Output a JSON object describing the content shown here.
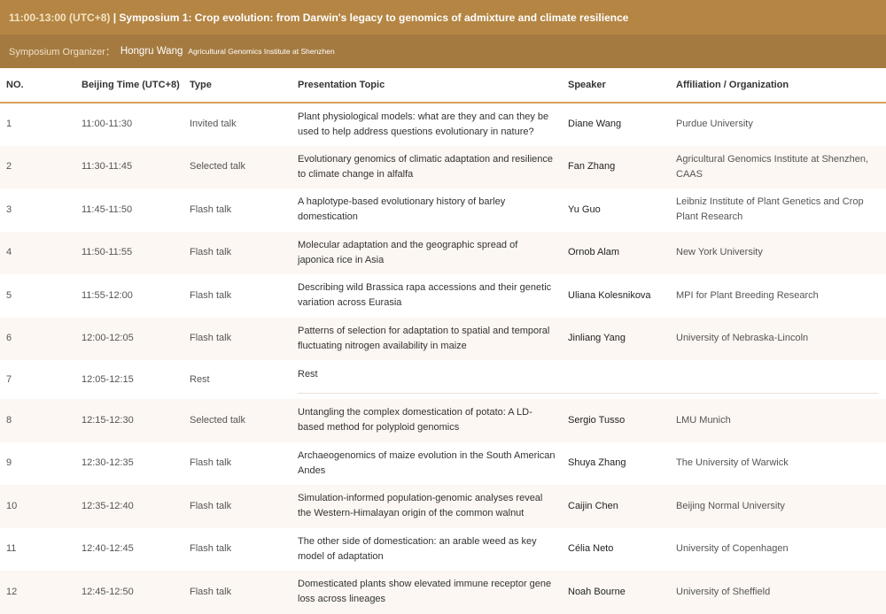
{
  "header": {
    "time": "11:00-13:00 (UTC+8)",
    "separator": " | ",
    "title": "Symposium 1: Crop evolution: from Darwin's legacy to genomics of admixture and climate resilience"
  },
  "organizer": {
    "label": "Symposium Organizer：",
    "name": "Hongru Wang",
    "institution": "Agricultural Genomics Institute at Shenzhen"
  },
  "columns": [
    "NO.",
    "Beijing Time (UTC+8)",
    "Type",
    "Presentation Topic",
    "Speaker",
    "Affiliation / Organization"
  ],
  "rows": [
    {
      "no": "1",
      "time": "11:00-11:30",
      "type": "Invited talk",
      "topic": "Plant physiological models: what are they and can they be used to help address questions evolutionary in nature?",
      "speaker": "Diane Wang",
      "affiliation": "Purdue University"
    },
    {
      "no": "2",
      "time": "11:30-11:45",
      "type": "Selected talk",
      "topic": "Evolutionary genomics of climatic adaptation and resilience to climate change in alfalfa",
      "speaker": "Fan Zhang",
      "affiliation": "Agricultural Genomics Institute at Shenzhen, CAAS"
    },
    {
      "no": "3",
      "time": "11:45-11:50",
      "type": "Flash talk",
      "topic": "A haplotype-based evolutionary history of barley domestication",
      "speaker": "Yu Guo",
      "affiliation": "Leibniz Institute of Plant Genetics and Crop Plant Research"
    },
    {
      "no": "4",
      "time": "11:50-11:55",
      "type": "Flash talk",
      "topic": "Molecular adaptation and the geographic spread of japonica rice in Asia",
      "speaker": "Ornob Alam",
      "affiliation": "New York University"
    },
    {
      "no": "5",
      "time": "11:55-12:00",
      "type": "Flash talk",
      "topic": "Describing wild Brassica rapa accessions and their genetic variation across Eurasia",
      "speaker": "Uliana Kolesnikova",
      "affiliation": "MPI for Plant Breeding Research"
    },
    {
      "no": "6",
      "time": "12:00-12:05",
      "type": "Flash talk",
      "topic": "Patterns of selection for adaptation to spatial and temporal fluctuating nitrogen availability in maize",
      "speaker": "Jinliang Yang",
      "affiliation": "University of Nebraska-Lincoln"
    },
    {
      "no": "7",
      "time": "12:05-12:15",
      "type": "Rest",
      "topic": "Rest",
      "speaker": "",
      "affiliation": ""
    },
    {
      "no": "8",
      "time": "12:15-12:30",
      "type": "Selected talk",
      "topic": "Untangling the complex domestication of potato: A LD-based method for polyploid genomics",
      "speaker": "Sergio Tusso",
      "affiliation": "LMU Munich"
    },
    {
      "no": "9",
      "time": "12:30-12:35",
      "type": "Flash talk",
      "topic": "Archaeogenomics of maize evolution in the South American Andes",
      "speaker": "Shuya Zhang",
      "affiliation": "The University of Warwick"
    },
    {
      "no": "10",
      "time": "12:35-12:40",
      "type": "Flash talk",
      "topic": "Simulation-informed population-genomic analyses reveal the Western-Himalayan origin of the common walnut",
      "speaker": "Caijin Chen",
      "affiliation": "Beijing Normal University"
    },
    {
      "no": "11",
      "time": "12:40-12:45",
      "type": "Flash talk",
      "topic": "The other side of domestication: an arable weed as key model of adaptation",
      "speaker": "Célia Neto",
      "affiliation": "University of Copenhagen"
    },
    {
      "no": "12",
      "time": "12:45-12:50",
      "type": "Flash talk",
      "topic": "Domesticated plants show elevated immune receptor gene loss across lineages",
      "speaker": "Noah Bourne",
      "affiliation": "University of Sheffield"
    }
  ]
}
